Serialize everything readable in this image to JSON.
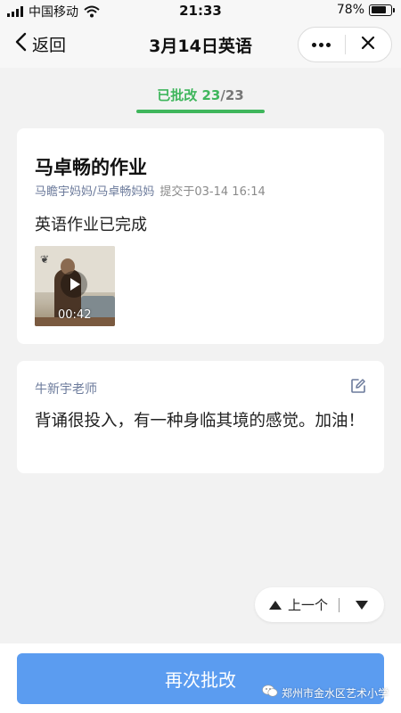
{
  "status_bar": {
    "carrier": "中国移动",
    "time": "21:33",
    "battery": "78%",
    "battery_level": 0.78
  },
  "nav": {
    "back_label": "返回",
    "title": "3月14日英语"
  },
  "progress": {
    "label": "已批改",
    "done": "23",
    "sep": "/",
    "total": "23"
  },
  "homework": {
    "title": "马卓畅的作业",
    "submitter": "马瞻宇妈妈/马卓畅妈妈",
    "submitted_at": "提交于03-14 16:14",
    "content": "英语作业已完成",
    "video_duration": "00:42"
  },
  "comment": {
    "teacher": "牛新宇老师",
    "text": "背诵很投入，有一种身临其境的感觉。加油！"
  },
  "pager": {
    "prev_label": "上一个"
  },
  "bottom": {
    "redo_label": "再次批改",
    "watermark": "郑州市金水区艺术小学"
  },
  "colors": {
    "accent_green": "#3fb65c",
    "button_blue": "#5b9cf0",
    "meta_text": "#6b7a9b"
  },
  "icons": [
    "signal-icon",
    "wifi-icon",
    "battery-icon",
    "back-chevron-icon",
    "more-dots-icon",
    "close-icon",
    "play-icon",
    "edit-icon",
    "arrow-up-icon",
    "arrow-down-icon",
    "wechat-icon"
  ]
}
